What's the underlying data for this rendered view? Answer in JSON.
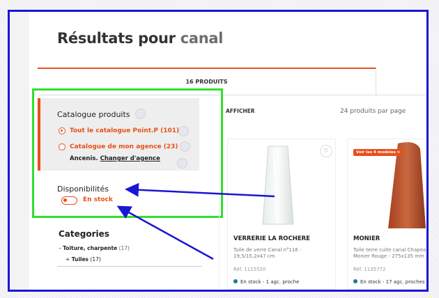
{
  "page": {
    "title_prefix": "Résultats pour",
    "title_query": "canal"
  },
  "tabs": [
    {
      "label": "16 PRODUITS",
      "active": true
    }
  ],
  "filters": {
    "catalogue": {
      "title": "Catalogue produits",
      "options": [
        {
          "label": "Tout le catalogue Point.P (101)",
          "selected": true
        },
        {
          "label": "Catalogue de mon agence (23)",
          "selected": false
        }
      ],
      "agency_name": "Ancenis.",
      "agency_link": "Changer d'agence"
    },
    "disponibilites": {
      "title": "Disponibilités",
      "toggle_label": "En stock",
      "toggle_on": false
    },
    "categories": {
      "title": "Categories",
      "items": [
        {
          "prefix": "–",
          "label": "Toiture, charpente",
          "count": "(17)"
        },
        {
          "prefix": "+",
          "label": "Tuiles",
          "count": "(17)"
        }
      ]
    }
  },
  "results": {
    "afficher_label": "AFFICHER",
    "per_page_label": "24 produits par page",
    "products": [
      {
        "brand": "VERRERIE LA ROCHERE",
        "description": "Tuile de verre Canal n°116 - 19,5/15,2x47 cm",
        "ref": "Réf. 1115520",
        "availability": "En stock - 1 agc. proche",
        "badge": ""
      },
      {
        "brand": "MONIER",
        "description": "Tuile terre cuite canal Chapeau Monier Rouge - 275x135 mm",
        "ref": "Réf. 1135772",
        "availability": "En stock - 17 agc. proches",
        "badge": "Voir les 4 modèles >"
      }
    ]
  },
  "colors": {
    "accent": "#e8501a",
    "annotation_frame": "#1a16d4",
    "annotation_box": "#2fe02f"
  }
}
